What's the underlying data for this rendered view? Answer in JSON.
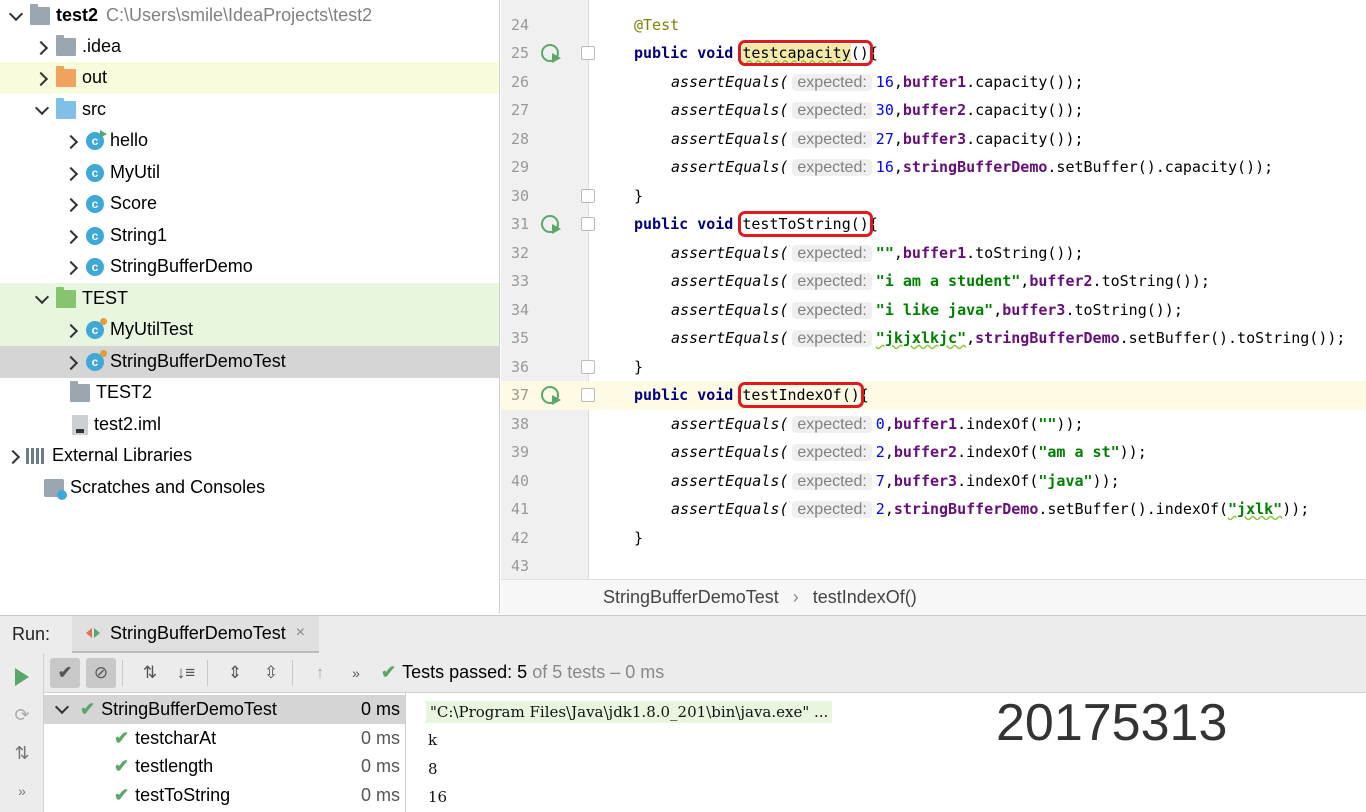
{
  "project": {
    "name": "test2",
    "path": "C:\\Users\\smile\\IdeaProjects\\test2",
    "items": [
      {
        "label": "test2",
        "path": "C:\\Users\\smile\\IdeaProjects\\test2",
        "type": "folder-gray",
        "expand": "open"
      },
      {
        "label": ".idea",
        "type": "folder-gray",
        "expand": "closed"
      },
      {
        "label": "out",
        "type": "folder-orange",
        "expand": "closed"
      },
      {
        "label": "src",
        "type": "folder-blue",
        "expand": "open"
      },
      {
        "label": "hello",
        "type": "class-run",
        "expand": "closed"
      },
      {
        "label": "MyUtil",
        "type": "class",
        "expand": "closed"
      },
      {
        "label": "Score",
        "type": "class",
        "expand": "closed"
      },
      {
        "label": "String1",
        "type": "class",
        "expand": "closed"
      },
      {
        "label": "StringBufferDemo",
        "type": "class",
        "expand": "closed"
      },
      {
        "label": "TEST",
        "type": "folder-green",
        "expand": "open"
      },
      {
        "label": "MyUtilTest",
        "type": "class-test",
        "expand": "closed"
      },
      {
        "label": "StringBufferDemoTest",
        "type": "class-test",
        "expand": "closed"
      },
      {
        "label": "TEST2",
        "type": "folder-gray",
        "expand": "none"
      },
      {
        "label": "test2.iml",
        "type": "iml",
        "expand": "none"
      },
      {
        "label": "External Libraries",
        "type": "lib",
        "expand": "closed"
      },
      {
        "label": "Scratches and Consoles",
        "type": "scratch",
        "expand": "none"
      }
    ]
  },
  "editor": {
    "lines": [
      "24",
      "25",
      "26",
      "27",
      "28",
      "29",
      "30",
      "31",
      "32",
      "33",
      "34",
      "35",
      "36",
      "37",
      "38",
      "39",
      "40",
      "41",
      "42",
      "43"
    ],
    "hint": "expected:",
    "annotation": "@Test",
    "kw_public": "public",
    "kw_void": "void",
    "assert": "assertEquals(",
    "m1": "testcapacity",
    "m2": "testToString",
    "m3": "testIndexOf",
    "parens": "()",
    "brace_open": "{",
    "brace_close": "}",
    "l26": {
      "num": "16",
      "fld": "buffer1",
      "rest": ".capacity());"
    },
    "l27": {
      "num": "30",
      "fld": "buffer2",
      "rest": ".capacity());"
    },
    "l28": {
      "num": "27",
      "fld": "buffer3",
      "rest": ".capacity());"
    },
    "l29": {
      "num": "16",
      "fld": "stringBufferDemo",
      "rest": ".setBuffer().capacity());"
    },
    "l32": {
      "str": "\"\"",
      "fld": "buffer1",
      "rest": ".toString());"
    },
    "l33": {
      "str": "\"i am a student\"",
      "fld": "buffer2",
      "rest": ".toString());"
    },
    "l34": {
      "str": "\"i like java\"",
      "fld": "buffer3",
      "rest": ".toString());"
    },
    "l35": {
      "str": "\"jkjxlkjc\"",
      "fld": "stringBufferDemo",
      "rest": ".setBuffer().toString());"
    },
    "l38": {
      "num": "0",
      "fld": "buffer1",
      "pre": ".indexOf(",
      "str": "\"\"",
      "rest": "));"
    },
    "l39": {
      "num": "2",
      "fld": "buffer2",
      "pre": ".indexOf(",
      "str": "\"am a st\"",
      "rest": "));"
    },
    "l40": {
      "num": "7",
      "fld": "buffer3",
      "pre": ".indexOf(",
      "str": "\"java\"",
      "rest": "));"
    },
    "l41": {
      "num": "2",
      "fld": "stringBufferDemo",
      "pre": ".setBuffer().indexOf(",
      "str": "\"jxlk\"",
      "rest": "));"
    }
  },
  "breadcrumb": {
    "cls": "StringBufferDemoTest",
    "sep": "›",
    "method": "testIndexOf()"
  },
  "run": {
    "label": "Run:",
    "tab": "StringBufferDemoTest",
    "close": "×",
    "status_prefix": "Tests passed:",
    "status_count": "5",
    "status_suffix": "of 5 tests – 0 ms",
    "tests": [
      {
        "name": "StringBufferDemoTest",
        "time": "0 ms"
      },
      {
        "name": "testcharAt",
        "time": "0 ms"
      },
      {
        "name": "testlength",
        "time": "0 ms"
      },
      {
        "name": "testToString",
        "time": "0 ms"
      }
    ],
    "console": [
      "\"C:\\Program Files\\Java\\jdk1.8.0_201\\bin\\java.exe\" ...",
      "k",
      "8",
      "16"
    ],
    "watermark": "20175313"
  },
  "colors": {
    "accent_green": "#59a869",
    "highlight_red": "#e0191f"
  }
}
